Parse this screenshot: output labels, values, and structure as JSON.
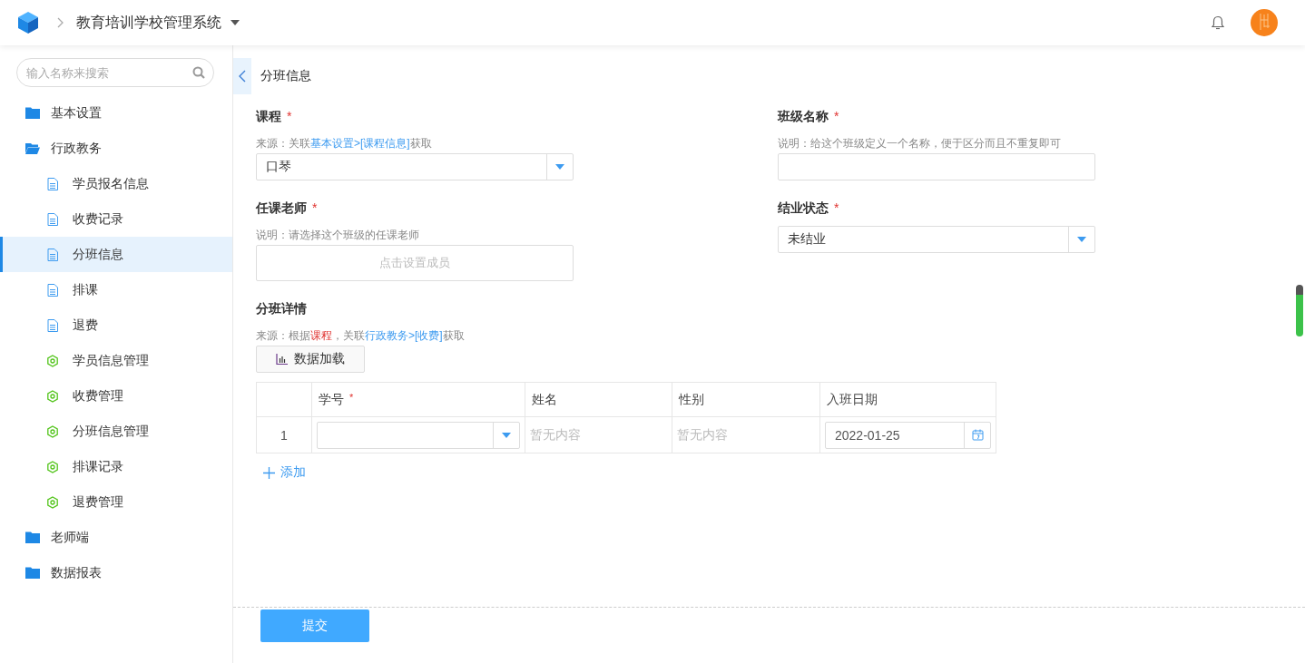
{
  "header": {
    "app_title": "教育培训学校管理系统"
  },
  "sidebar": {
    "search": {
      "placeholder": "输入名称来搜索"
    },
    "items": [
      {
        "label": "基本设置",
        "kind": "folder",
        "expanded": false,
        "selected": false
      },
      {
        "label": "行政教务",
        "kind": "folder",
        "expanded": true,
        "selected": false,
        "children": [
          {
            "label": "学员报名信息",
            "kind": "page",
            "selected": false
          },
          {
            "label": "收费记录",
            "kind": "page",
            "selected": false
          },
          {
            "label": "分班信息",
            "kind": "page",
            "selected": true
          },
          {
            "label": "排课",
            "kind": "page",
            "selected": false
          },
          {
            "label": "退费",
            "kind": "page",
            "selected": false
          },
          {
            "label": "学员信息管理",
            "kind": "report",
            "selected": false
          },
          {
            "label": "收费管理",
            "kind": "report",
            "selected": false
          },
          {
            "label": "分班信息管理",
            "kind": "report",
            "selected": false
          },
          {
            "label": "排课记录",
            "kind": "report",
            "selected": false
          },
          {
            "label": "退费管理",
            "kind": "report",
            "selected": false
          }
        ]
      },
      {
        "label": "老师端",
        "kind": "folder",
        "expanded": false,
        "selected": false
      },
      {
        "label": "数据报表",
        "kind": "folder",
        "expanded": false,
        "selected": false
      }
    ]
  },
  "page": {
    "title": "分班信息"
  },
  "form": {
    "fields": [
      {
        "label": "课程",
        "required_mark": "*",
        "kind": "select",
        "value": "口琴",
        "hint": [
          {
            "kind": "plain",
            "text": "来源：关联"
          },
          {
            "kind": "link",
            "text": "基本设置>"
          },
          {
            "kind": "link",
            "text": "[课程信息]"
          },
          {
            "kind": "plain",
            "text": "获取"
          }
        ]
      },
      {
        "label": "班级名称",
        "required_mark": "*",
        "kind": "text",
        "hint": [
          {
            "kind": "plain",
            "text": "说明：给这个班级定义一个名称，便于区分而且不重复即可"
          }
        ]
      },
      {
        "label": "任课老师",
        "required_mark": "*",
        "kind": "member",
        "placeholder": "点击设置成员",
        "hint": [
          {
            "kind": "plain",
            "text": "说明：请选择这个班级的任课老师"
          }
        ]
      },
      {
        "label": "结业状态",
        "required_mark": "*",
        "kind": "select",
        "value": "未结业"
      }
    ],
    "detail": {
      "label": "分班详情",
      "hint": [
        {
          "kind": "plain",
          "text": "来源：根据"
        },
        {
          "kind": "accent",
          "text": "课程"
        },
        {
          "kind": "plain",
          "text": "，关联"
        },
        {
          "kind": "link",
          "text": "行政教务>"
        },
        {
          "kind": "link",
          "text": "[收费]"
        },
        {
          "kind": "plain",
          "text": "获取"
        }
      ],
      "load_button": "数据加载",
      "table": {
        "columns": [
          {
            "label": "学号",
            "required_mark": "*"
          },
          {
            "label": "姓名"
          },
          {
            "label": "性别"
          },
          {
            "label": "入班日期"
          }
        ],
        "rows": [
          {
            "index": "1",
            "cells": [
              {
                "kind": "select"
              },
              {
                "kind": "empty",
                "placeholder": "暂无内容"
              },
              {
                "kind": "empty",
                "placeholder": "暂无内容"
              },
              {
                "kind": "date",
                "value": "2022-01-25"
              }
            ]
          }
        ]
      },
      "add_button": "添加"
    },
    "submit_button": "提交"
  }
}
